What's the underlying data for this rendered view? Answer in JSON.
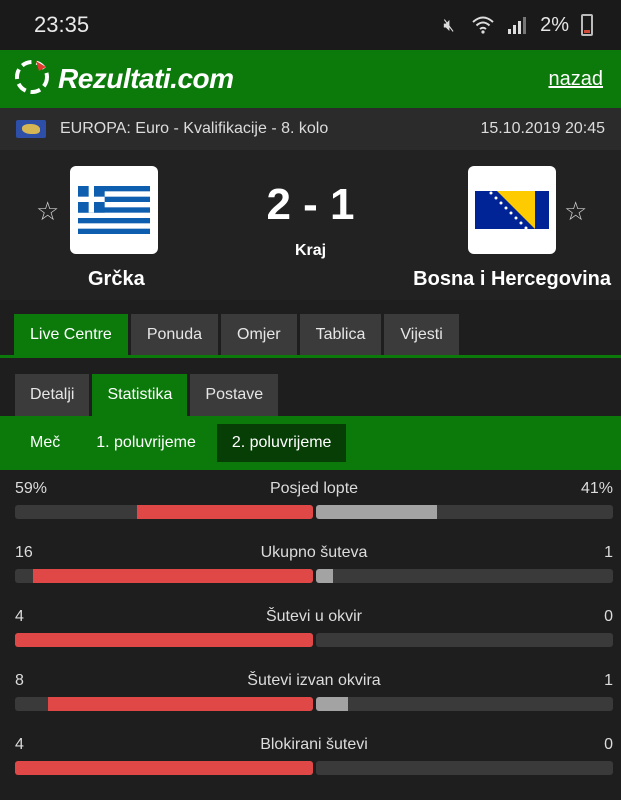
{
  "status": {
    "time": "23:35",
    "battery": "2%"
  },
  "header": {
    "brand": "Rezultati.com",
    "back": "nazad"
  },
  "competition": {
    "name": "EUROPA: Euro - Kvalifikacije - 8. kolo",
    "datetime": "15.10.2019 20:45"
  },
  "match": {
    "home": "Grčka",
    "away": "Bosna i Hercegovina",
    "score": "2 - 1",
    "state": "Kraj"
  },
  "main_tabs": [
    "Live Centre",
    "Ponuda",
    "Omjer",
    "Tablica",
    "Vijesti"
  ],
  "sub_tabs": [
    "Detalji",
    "Statistika",
    "Postave"
  ],
  "periods": [
    "Meč",
    "1. poluvrijeme",
    "2. poluvrijeme"
  ],
  "stats": [
    {
      "name": "Posjed lopte",
      "home": "59%",
      "away": "41%",
      "home_share": 0.59,
      "away_share": 0.41
    },
    {
      "name": "Ukupno šuteva",
      "home": "16",
      "away": "1",
      "home_share": 0.94,
      "away_share": 0.06
    },
    {
      "name": "Šutevi u okvir",
      "home": "4",
      "away": "0",
      "home_share": 1.0,
      "away_share": 0.0
    },
    {
      "name": "Šutevi izvan okvira",
      "home": "8",
      "away": "1",
      "home_share": 0.89,
      "away_share": 0.11
    },
    {
      "name": "Blokirani šutevi",
      "home": "4",
      "away": "0",
      "home_share": 1.0,
      "away_share": 0.0
    }
  ],
  "colors": {
    "brand_green": "#0b7a0b",
    "home_bar": "#e04848",
    "away_bar": "#a3a3a3"
  }
}
